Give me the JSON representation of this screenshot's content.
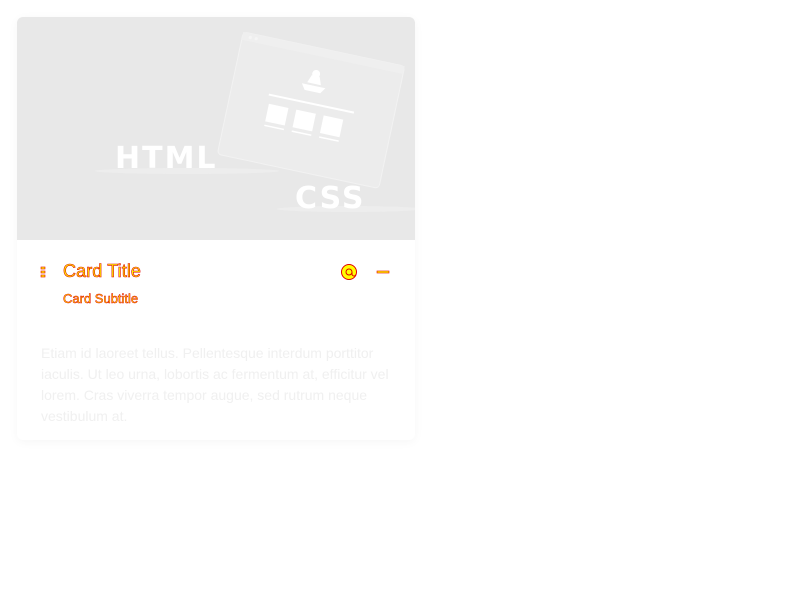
{
  "card": {
    "media": {
      "text_html": "HTML",
      "text_css": "CSS",
      "icons": [
        "html-logo-graphic",
        "css-logo-graphic",
        "mockup-graphic"
      ]
    },
    "title": "Card Title",
    "subtitle": "Card Subtitle",
    "actions": [
      {
        "icon": "at-icon"
      },
      {
        "icon": "more-icon"
      }
    ],
    "body": "Etiam id laoreet tellus. Pellentesque interdum porttitor iaculis. Ut leo urna, lobortis ac fermentum at, efficitur vel lorem. Cras viverra tempor augue, sed rutrum neque vestibulum at."
  },
  "colors": {
    "media_background": "#e8e8e8",
    "header_text_fill": "#ffff00",
    "header_text_outline": "#e00000",
    "body_text": "#f0f0f0"
  }
}
